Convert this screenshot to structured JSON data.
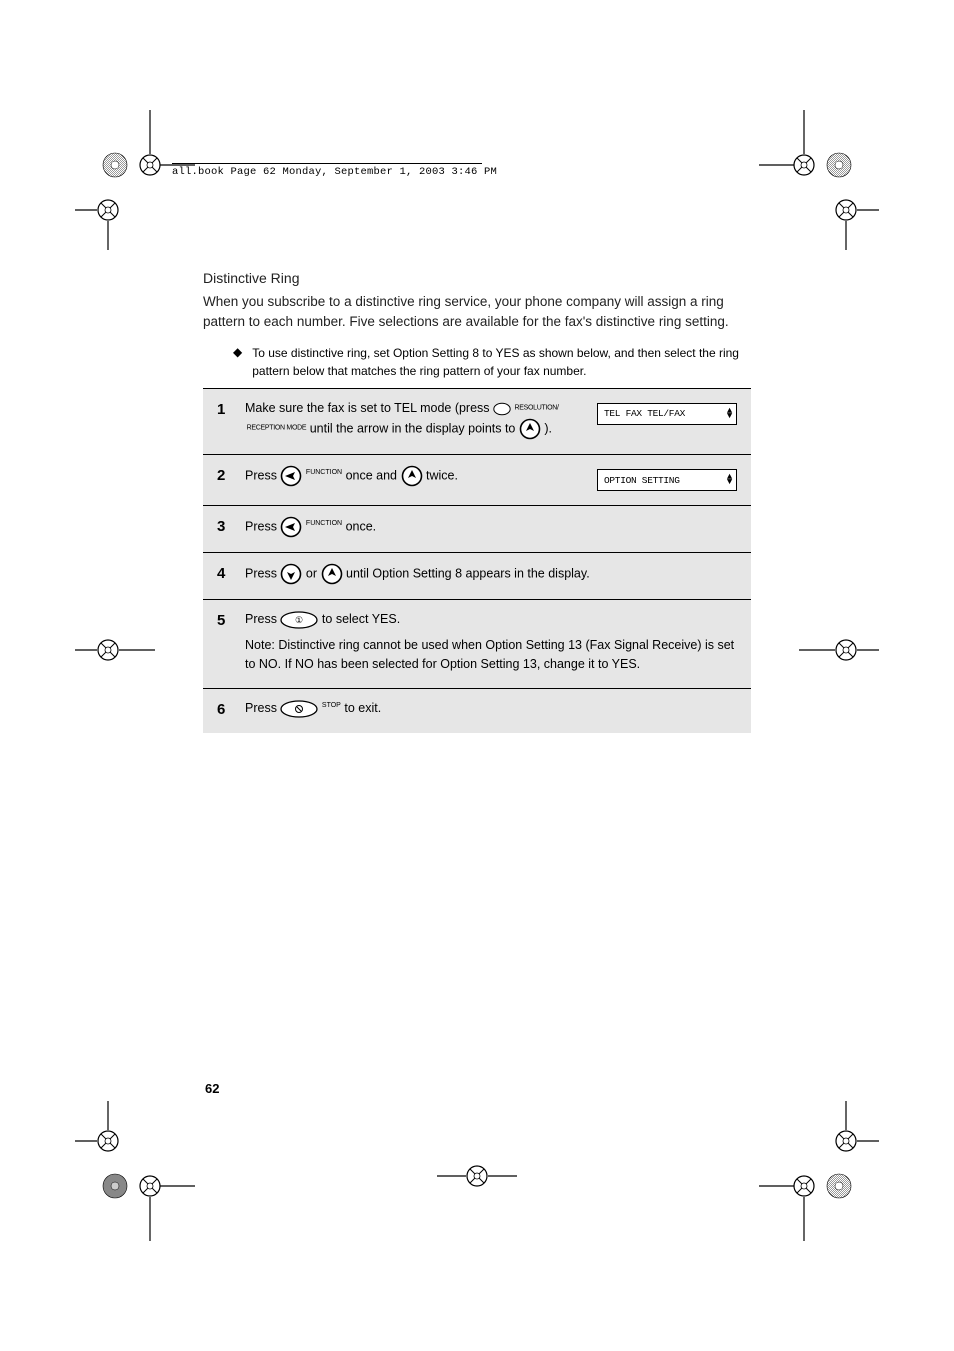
{
  "header_strip": "all.book  Page 62  Monday, September 1, 2003  3:46 PM",
  "section": {
    "title": "Distinctive Ring",
    "lead": "When you subscribe to a distinctive ring service, your phone company will assign a ring pattern to each number. Five selections are available for the fax's distinctive ring setting.",
    "bullet": "To use distinctive ring, set Option Setting 8 to YES as shown below, and then select the ring pattern below that matches the ring pattern of your fax number."
  },
  "steps": [
    {
      "num": "1",
      "lines": [
        "Make sure the fax is set to TEL mode (press {RESOLUTION_ICON} until the arrow in the display points to {TEL})."
      ],
      "display": "TEL    FAX    TEL/FAX"
    },
    {
      "num": "2",
      "lines": [
        "Press {FUNCTION_ICON} once and {UP_ICON} twice."
      ],
      "display": "OPTION SETTING"
    },
    {
      "num": "3",
      "lines": [
        "Press {FUNCTION_ICON} once."
      ]
    },
    {
      "num": "4",
      "lines": [
        "Press {DOWN_ICON} or {UP_ICON} until Option Setting 8 appears in the display."
      ]
    },
    {
      "num": "5",
      "lines": [
        "Press {KEY1_ICON} to select YES.",
        "Note: Distinctive ring cannot be used when Option Setting 13 (Fax Signal Receive) is set to NO. If NO has been selected for Option Setting 13, change it to YES."
      ]
    },
    {
      "num": "6",
      "lines": [
        "Press {STOP_ICON} to exit."
      ]
    }
  ],
  "page_number": "62"
}
